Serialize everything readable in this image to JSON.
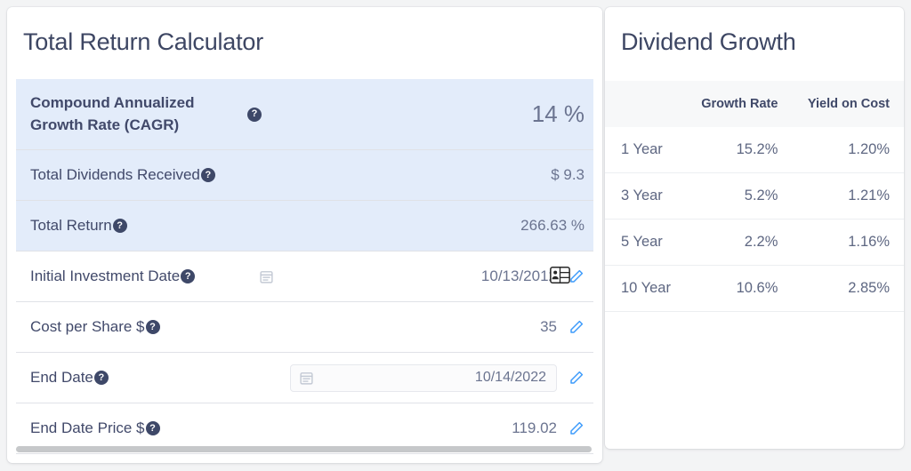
{
  "calculator": {
    "title": "Total Return Calculator",
    "rows": [
      {
        "label": "Compound Annualized Growth Rate (CAGR)",
        "value": "14 %",
        "help": "?"
      },
      {
        "label": "Total Dividends Received",
        "value": "$ 9.3",
        "help": "?"
      },
      {
        "label": "Total Return",
        "value": "266.63 %",
        "help": "?"
      },
      {
        "label": "Initial Investment Date",
        "value": "10/13/2012",
        "help": "?"
      },
      {
        "label": "Cost per Share $",
        "value": "35",
        "help": "?"
      },
      {
        "label": "End Date",
        "value": "10/14/2022",
        "help": "?"
      },
      {
        "label": "End Date Price $",
        "value": "119.02",
        "help": "?"
      }
    ]
  },
  "dividend_growth": {
    "title": "Dividend Growth",
    "columns": [
      "",
      "Growth Rate",
      "Yield on Cost"
    ],
    "rows": [
      {
        "period": "1 Year",
        "growth_rate": "15.2%",
        "yield_on_cost": "1.20%"
      },
      {
        "period": "3 Year",
        "growth_rate": "5.2%",
        "yield_on_cost": "1.21%"
      },
      {
        "period": "5 Year",
        "growth_rate": "2.2%",
        "yield_on_cost": "1.16%"
      },
      {
        "period": "10 Year",
        "growth_rate": "10.6%",
        "yield_on_cost": "2.85%"
      }
    ]
  },
  "colors": {
    "highlight_row": "#e3ecfa",
    "heading": "#3d4663",
    "value": "#6b7490",
    "accent_pencil": "#3d9bfb",
    "help_badge": "#3e4868"
  }
}
